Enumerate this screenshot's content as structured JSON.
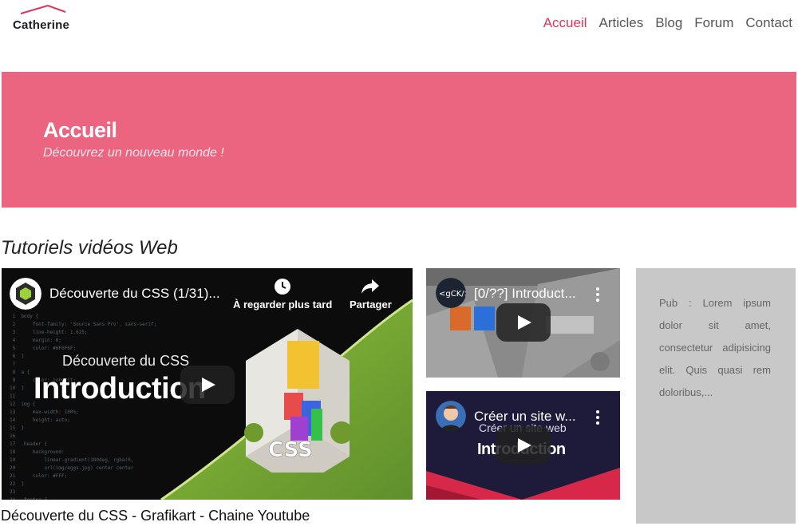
{
  "brand": {
    "name": "Catherine"
  },
  "nav": {
    "items": [
      {
        "label": "Accueil",
        "active": true
      },
      {
        "label": "Articles",
        "active": false
      },
      {
        "label": "Blog",
        "active": false
      },
      {
        "label": "Forum",
        "active": false
      },
      {
        "label": "Contact",
        "active": false
      }
    ]
  },
  "hero": {
    "title": "Accueil",
    "subtitle": "Découvrez un nouveau monde !",
    "background": "#eb6480"
  },
  "section": {
    "title": "Tutoriels vidéos Web"
  },
  "videos": {
    "main": {
      "title": "Découverte du CSS (1/31)...",
      "watch_later": "À regarder plus tard",
      "share": "Partager",
      "thumb_subtitle": "Découverte du CSS",
      "thumb_heading": "Introduction",
      "caption": "Découverte du CSS - Grafikart - Chaine Youtube",
      "channel_icon": "grafikart-logo"
    },
    "side1": {
      "title": "[0/??] Introduct...",
      "channel_icon": "gck-logo"
    },
    "side2": {
      "title": "Créer un site w...",
      "thumb_subtitle": "Créer un site web",
      "thumb_heading": "Introduction",
      "channel_icon": "avatar"
    }
  },
  "ad": {
    "text": "Pub : Lorem ipsum dolor sit amet, consectetur adipisicing elit. Quis quasi rem doloribus,..."
  },
  "colors": {
    "accent": "#e0355a",
    "ad_bg": "#c8c8c8"
  }
}
